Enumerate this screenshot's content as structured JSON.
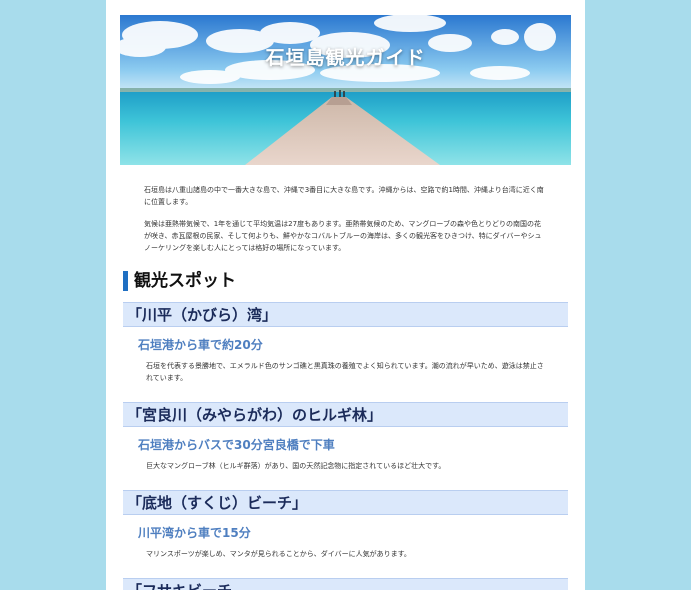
{
  "hero": {
    "title": "石垣島観光ガイド"
  },
  "intro": {
    "paragraph1": "石垣島は八重山諸島の中で一番大きな島で、沖縄で3番目に大きな島です。沖縄からは、空路で約1時間、沖縄より台湾に近く南に位置します。",
    "paragraph2": "気候は亜熱帯気候で、1年を通じて平均気温は27度もあります。亜熱帯気候のため、マングローブの森や色とりどりの南国の花が咲き、赤瓦屋根の民家、そして何よりも、鮮やかなコバルトブルーの海岸は、多くの観光客をひきつけ、特にダイバーやシュノーケリングを楽しむ人にとっては格好の場所になっています。"
  },
  "section": {
    "heading": "観光スポット"
  },
  "spots": [
    {
      "title": "「川平（かびら）湾」",
      "access": "石垣港から車で約20分",
      "description": "石垣を代表する景勝地で、エメラルド色のサンゴ礁と黒真珠の養殖でよく知られています。潮の流れが早いため、遊泳は禁止されています。"
    },
    {
      "title": "「宮良川（みやらがわ）のヒルギ林」",
      "access": "石垣港からバスで30分宮良橋で下車",
      "description": "巨大なマングローブ林（ヒルギ群落）があり、国の天然記念物に指定されているほど壮大です。"
    },
    {
      "title": "「底地（すくじ）ビーチ」",
      "access": "川平湾から車で15分",
      "description": "マリンスポーツが楽しめ、マンタが見られることから、ダイバーに人気があります。"
    },
    {
      "title": "「フサキビーチ"
    }
  ]
}
